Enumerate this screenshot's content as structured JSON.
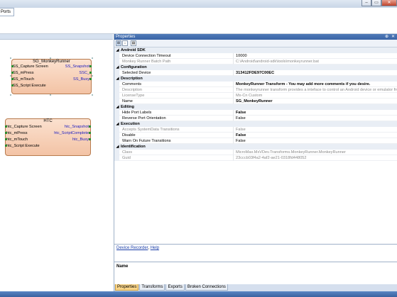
{
  "window": {
    "buttons": [
      "minimize-icon",
      "maximize-icon",
      "close-icon"
    ],
    "glyphs": {
      "min": "–",
      "max": "▭",
      "close": "✕"
    }
  },
  "ribbon": {
    "ports_tab": "Ports"
  },
  "canvas": {
    "blocks": [
      {
        "title": "SG_MonkeyRunner",
        "inputs": [
          "SS_Capture Screen",
          "SS_mPress",
          "SS_mTouch",
          "SS_Script Execute"
        ],
        "outputs": [
          "SS_Snapshot",
          "SSC_",
          "SS_Busy"
        ]
      },
      {
        "title": "HTC",
        "inputs": [
          "htc_Capture Screen",
          "htc_mPress",
          "htc_mTouch",
          "htc_Script Execute"
        ],
        "outputs": [
          "htc_Snapshot",
          "htc_ScriptComplete",
          "htc_Busy"
        ]
      }
    ]
  },
  "properties": {
    "title": "Properties",
    "pin_glyph": "⊕",
    "close_glyph": "✕",
    "toolbar": [
      "categorized-icon",
      "alphabetical-icon",
      "property-pages-icon"
    ],
    "toolbar_glyphs": [
      "⊞",
      "↓",
      "▤"
    ],
    "categories": [
      {
        "name": "Android SDK",
        "rows": [
          {
            "key": "Device Connection Timeout",
            "value": "10000",
            "style": ""
          },
          {
            "key": "Monkey Runner Batch Path",
            "value": "C:\\Android\\android-sdk\\tools\\monkeyrunner.bat",
            "style": "dim"
          }
        ]
      },
      {
        "name": "Configuration",
        "rows": [
          {
            "key": "Selected Device",
            "value": "313412FDE97C00EC",
            "style": "bold"
          }
        ]
      },
      {
        "name": "Description",
        "rows": [
          {
            "key": "Comments",
            "value": "MonkeyRunner Transform - You may add more comments if you desire.",
            "style": "bold"
          },
          {
            "key": "Description",
            "value": "The monkeyrunner transform provides a inteface to control an Android device or emulator from a",
            "style": "dim"
          },
          {
            "key": "LicenseType",
            "value": "Mx-Cn Custom",
            "style": "dim"
          },
          {
            "key": "Name",
            "value": "SG_MonkeyRunner",
            "style": "bold"
          }
        ]
      },
      {
        "name": "Editing",
        "rows": [
          {
            "key": "Hide Port Labels",
            "value": "False",
            "style": "bold"
          },
          {
            "key": "Reverse Port Orientation",
            "value": "False",
            "style": ""
          }
        ]
      },
      {
        "name": "Execution",
        "rows": [
          {
            "key": "Accepts SystemData Transitions",
            "value": "False",
            "style": "dim"
          },
          {
            "key": "Disable",
            "value": "False",
            "style": "bold"
          },
          {
            "key": "Warn On Future Transitions",
            "value": "False",
            "style": ""
          }
        ]
      },
      {
        "name": "Identification",
        "rows": [
          {
            "key": "Class",
            "value": "MicroMax.MxVDev.Transforms.MonkeyRunner.MonkeyRunner",
            "style": "dim"
          },
          {
            "key": "Guid",
            "value": "23cccb03f4a2-4af2-ae21-0318fd448052",
            "style": "dim"
          }
        ]
      }
    ],
    "links": {
      "device_recorder": "Device Recorder",
      "separator": ",",
      "help": "Help"
    },
    "selected_name_label": "Name",
    "tabs": [
      "Properties",
      "Transforms",
      "Exports",
      "Broken Connections"
    ],
    "active_tab": 0
  }
}
